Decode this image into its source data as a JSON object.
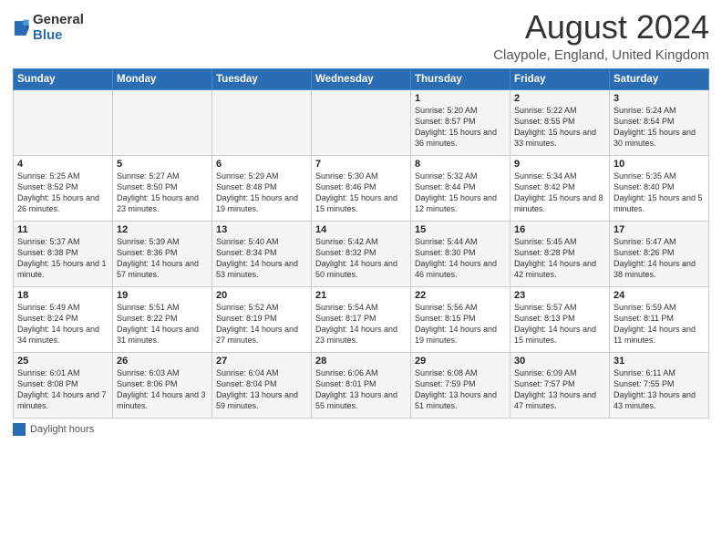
{
  "logo": {
    "general": "General",
    "blue": "Blue"
  },
  "title": "August 2024",
  "subtitle": "Claypole, England, United Kingdom",
  "days_of_week": [
    "Sunday",
    "Monday",
    "Tuesday",
    "Wednesday",
    "Thursday",
    "Friday",
    "Saturday"
  ],
  "footer": {
    "legend_label": "Daylight hours"
  },
  "weeks": [
    [
      {
        "day": "",
        "info": ""
      },
      {
        "day": "",
        "info": ""
      },
      {
        "day": "",
        "info": ""
      },
      {
        "day": "",
        "info": ""
      },
      {
        "day": "1",
        "info": "Sunrise: 5:20 AM\nSunset: 8:57 PM\nDaylight: 15 hours\nand 36 minutes."
      },
      {
        "day": "2",
        "info": "Sunrise: 5:22 AM\nSunset: 8:55 PM\nDaylight: 15 hours\nand 33 minutes."
      },
      {
        "day": "3",
        "info": "Sunrise: 5:24 AM\nSunset: 8:54 PM\nDaylight: 15 hours\nand 30 minutes."
      }
    ],
    [
      {
        "day": "4",
        "info": "Sunrise: 5:25 AM\nSunset: 8:52 PM\nDaylight: 15 hours\nand 26 minutes."
      },
      {
        "day": "5",
        "info": "Sunrise: 5:27 AM\nSunset: 8:50 PM\nDaylight: 15 hours\nand 23 minutes."
      },
      {
        "day": "6",
        "info": "Sunrise: 5:29 AM\nSunset: 8:48 PM\nDaylight: 15 hours\nand 19 minutes."
      },
      {
        "day": "7",
        "info": "Sunrise: 5:30 AM\nSunset: 8:46 PM\nDaylight: 15 hours\nand 15 minutes."
      },
      {
        "day": "8",
        "info": "Sunrise: 5:32 AM\nSunset: 8:44 PM\nDaylight: 15 hours\nand 12 minutes."
      },
      {
        "day": "9",
        "info": "Sunrise: 5:34 AM\nSunset: 8:42 PM\nDaylight: 15 hours\nand 8 minutes."
      },
      {
        "day": "10",
        "info": "Sunrise: 5:35 AM\nSunset: 8:40 PM\nDaylight: 15 hours\nand 5 minutes."
      }
    ],
    [
      {
        "day": "11",
        "info": "Sunrise: 5:37 AM\nSunset: 8:38 PM\nDaylight: 15 hours\nand 1 minute."
      },
      {
        "day": "12",
        "info": "Sunrise: 5:39 AM\nSunset: 8:36 PM\nDaylight: 14 hours\nand 57 minutes."
      },
      {
        "day": "13",
        "info": "Sunrise: 5:40 AM\nSunset: 8:34 PM\nDaylight: 14 hours\nand 53 minutes."
      },
      {
        "day": "14",
        "info": "Sunrise: 5:42 AM\nSunset: 8:32 PM\nDaylight: 14 hours\nand 50 minutes."
      },
      {
        "day": "15",
        "info": "Sunrise: 5:44 AM\nSunset: 8:30 PM\nDaylight: 14 hours\nand 46 minutes."
      },
      {
        "day": "16",
        "info": "Sunrise: 5:45 AM\nSunset: 8:28 PM\nDaylight: 14 hours\nand 42 minutes."
      },
      {
        "day": "17",
        "info": "Sunrise: 5:47 AM\nSunset: 8:26 PM\nDaylight: 14 hours\nand 38 minutes."
      }
    ],
    [
      {
        "day": "18",
        "info": "Sunrise: 5:49 AM\nSunset: 8:24 PM\nDaylight: 14 hours\nand 34 minutes."
      },
      {
        "day": "19",
        "info": "Sunrise: 5:51 AM\nSunset: 8:22 PM\nDaylight: 14 hours\nand 31 minutes."
      },
      {
        "day": "20",
        "info": "Sunrise: 5:52 AM\nSunset: 8:19 PM\nDaylight: 14 hours\nand 27 minutes."
      },
      {
        "day": "21",
        "info": "Sunrise: 5:54 AM\nSunset: 8:17 PM\nDaylight: 14 hours\nand 23 minutes."
      },
      {
        "day": "22",
        "info": "Sunrise: 5:56 AM\nSunset: 8:15 PM\nDaylight: 14 hours\nand 19 minutes."
      },
      {
        "day": "23",
        "info": "Sunrise: 5:57 AM\nSunset: 8:13 PM\nDaylight: 14 hours\nand 15 minutes."
      },
      {
        "day": "24",
        "info": "Sunrise: 5:59 AM\nSunset: 8:11 PM\nDaylight: 14 hours\nand 11 minutes."
      }
    ],
    [
      {
        "day": "25",
        "info": "Sunrise: 6:01 AM\nSunset: 8:08 PM\nDaylight: 14 hours\nand 7 minutes."
      },
      {
        "day": "26",
        "info": "Sunrise: 6:03 AM\nSunset: 8:06 PM\nDaylight: 14 hours\nand 3 minutes."
      },
      {
        "day": "27",
        "info": "Sunrise: 6:04 AM\nSunset: 8:04 PM\nDaylight: 13 hours\nand 59 minutes."
      },
      {
        "day": "28",
        "info": "Sunrise: 6:06 AM\nSunset: 8:01 PM\nDaylight: 13 hours\nand 55 minutes."
      },
      {
        "day": "29",
        "info": "Sunrise: 6:08 AM\nSunset: 7:59 PM\nDaylight: 13 hours\nand 51 minutes."
      },
      {
        "day": "30",
        "info": "Sunrise: 6:09 AM\nSunset: 7:57 PM\nDaylight: 13 hours\nand 47 minutes."
      },
      {
        "day": "31",
        "info": "Sunrise: 6:11 AM\nSunset: 7:55 PM\nDaylight: 13 hours\nand 43 minutes."
      }
    ]
  ]
}
